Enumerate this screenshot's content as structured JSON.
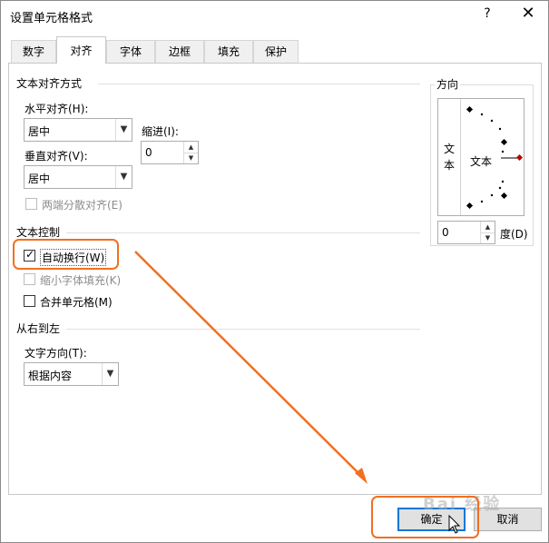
{
  "dialog": {
    "title": "设置单元格格式",
    "help": "?",
    "close": "✕"
  },
  "tabs": [
    {
      "label": "数字"
    },
    {
      "label": "对齐"
    },
    {
      "label": "字体"
    },
    {
      "label": "边框"
    },
    {
      "label": "填充"
    },
    {
      "label": "保护"
    }
  ],
  "active_tab": "对齐",
  "text_alignment": {
    "title": "文本对齐方式",
    "horizontal_label": "水平对齐(H):",
    "horizontal_value": "居中",
    "indent_label": "缩进(I):",
    "indent_value": "0",
    "vertical_label": "垂直对齐(V):",
    "vertical_value": "居中",
    "distributed_label": "两端分散对齐(E)"
  },
  "text_control": {
    "title": "文本控制",
    "wrap_text": {
      "label": "自动换行(W)",
      "checked": true
    },
    "shrink_to_fit": {
      "label": "缩小字体填充(K)",
      "checked": false
    },
    "merge_cells": {
      "label": "合并单元格(M)",
      "checked": false
    }
  },
  "rtl": {
    "title": "从右到左",
    "direction_label": "文字方向(T):",
    "direction_value": "根据内容"
  },
  "orientation": {
    "title": "方向",
    "vertical_text": "文\n本",
    "dial_text": "文本",
    "degrees_value": "0",
    "degrees_label": "度(D)"
  },
  "buttons": {
    "ok": "确定",
    "cancel": "取消"
  },
  "watermark": "Bai 经验",
  "colors": {
    "highlight": "#f26f21",
    "accent": "#0078d7",
    "dial_marker": "#c00000"
  }
}
